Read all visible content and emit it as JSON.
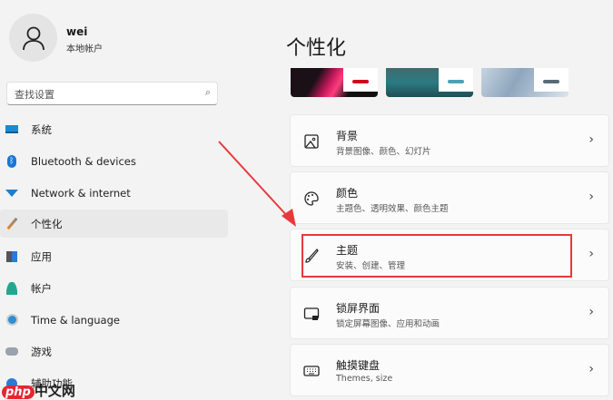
{
  "user": {
    "name": "wei",
    "type": "本地帐户"
  },
  "search": {
    "placeholder": "查找设置"
  },
  "sidebar": {
    "items": [
      {
        "label": "系统",
        "icon": "system-icon"
      },
      {
        "label": "Bluetooth & devices",
        "icon": "bluetooth-icon"
      },
      {
        "label": "Network & internet",
        "icon": "wifi-icon"
      },
      {
        "label": "个性化",
        "icon": "brush-icon",
        "selected": true
      },
      {
        "label": "应用",
        "icon": "apps-icon"
      },
      {
        "label": "帐户",
        "icon": "account-icon"
      },
      {
        "label": "Time & language",
        "icon": "globe-clock-icon"
      },
      {
        "label": "游戏",
        "icon": "gamepad-icon"
      },
      {
        "label": "辅助功能",
        "icon": "accessibility-icon"
      }
    ]
  },
  "main": {
    "title": "个性化",
    "themes": [
      {
        "accent": "#d0021b"
      },
      {
        "accent": "#4aa3b5"
      },
      {
        "accent": "#5a6a78"
      }
    ],
    "cards": [
      {
        "title": "背景",
        "subtitle": "背景图像、颜色、幻灯片",
        "icon": "image-icon"
      },
      {
        "title": "颜色",
        "subtitle": "主题色、透明效果、颜色主题",
        "icon": "palette-icon"
      },
      {
        "title": "主题",
        "subtitle": "安装、创建、管理",
        "icon": "brush-icon",
        "highlighted": true
      },
      {
        "title": "锁屏界面",
        "subtitle": "锁定屏幕图像、应用和动画",
        "icon": "lock-screen-icon"
      },
      {
        "title": "触摸键盘",
        "subtitle": "Themes, size",
        "icon": "keyboard-icon"
      }
    ]
  },
  "chevron": "›",
  "watermark": "php中文网"
}
